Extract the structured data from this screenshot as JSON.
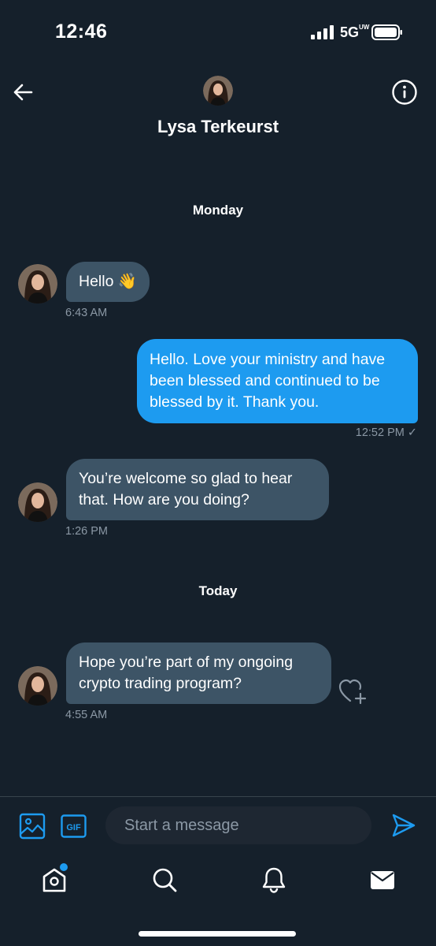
{
  "status_bar": {
    "time": "12:46",
    "network": "5G",
    "network_sub": "UW"
  },
  "header": {
    "contact_name": "Lysa Terkeurst"
  },
  "days": {
    "first": "Monday",
    "second": "Today"
  },
  "messages": [
    {
      "direction": "in",
      "text": "Hello 👋",
      "time": "6:43 AM"
    },
    {
      "direction": "out",
      "text": "Hello. Love your ministry and have been blessed and continued to be blessed by it. Thank you.",
      "time": "12:52 PM ✓"
    },
    {
      "direction": "in",
      "text": "You’re welcome so glad to hear that. How are you doing?",
      "time": "1:26 PM"
    },
    {
      "direction": "in",
      "text": "Hope you’re part of my ongoing crypto trading program?",
      "time": "4:55 AM"
    }
  ],
  "composer": {
    "placeholder": "Start a message",
    "gif_label": "GIF"
  },
  "colors": {
    "background": "#15202b",
    "accent": "#1d9bf0",
    "incoming_bubble": "#3d5466",
    "muted": "#8b98a5"
  },
  "icons": {
    "back": "arrow-left-icon",
    "info": "info-icon",
    "media": "image-icon",
    "gif": "gif-icon",
    "send": "send-icon",
    "heart": "heart-plus-icon",
    "home": "home-icon",
    "search": "search-icon",
    "notifications": "bell-icon",
    "messages": "mail-icon"
  }
}
